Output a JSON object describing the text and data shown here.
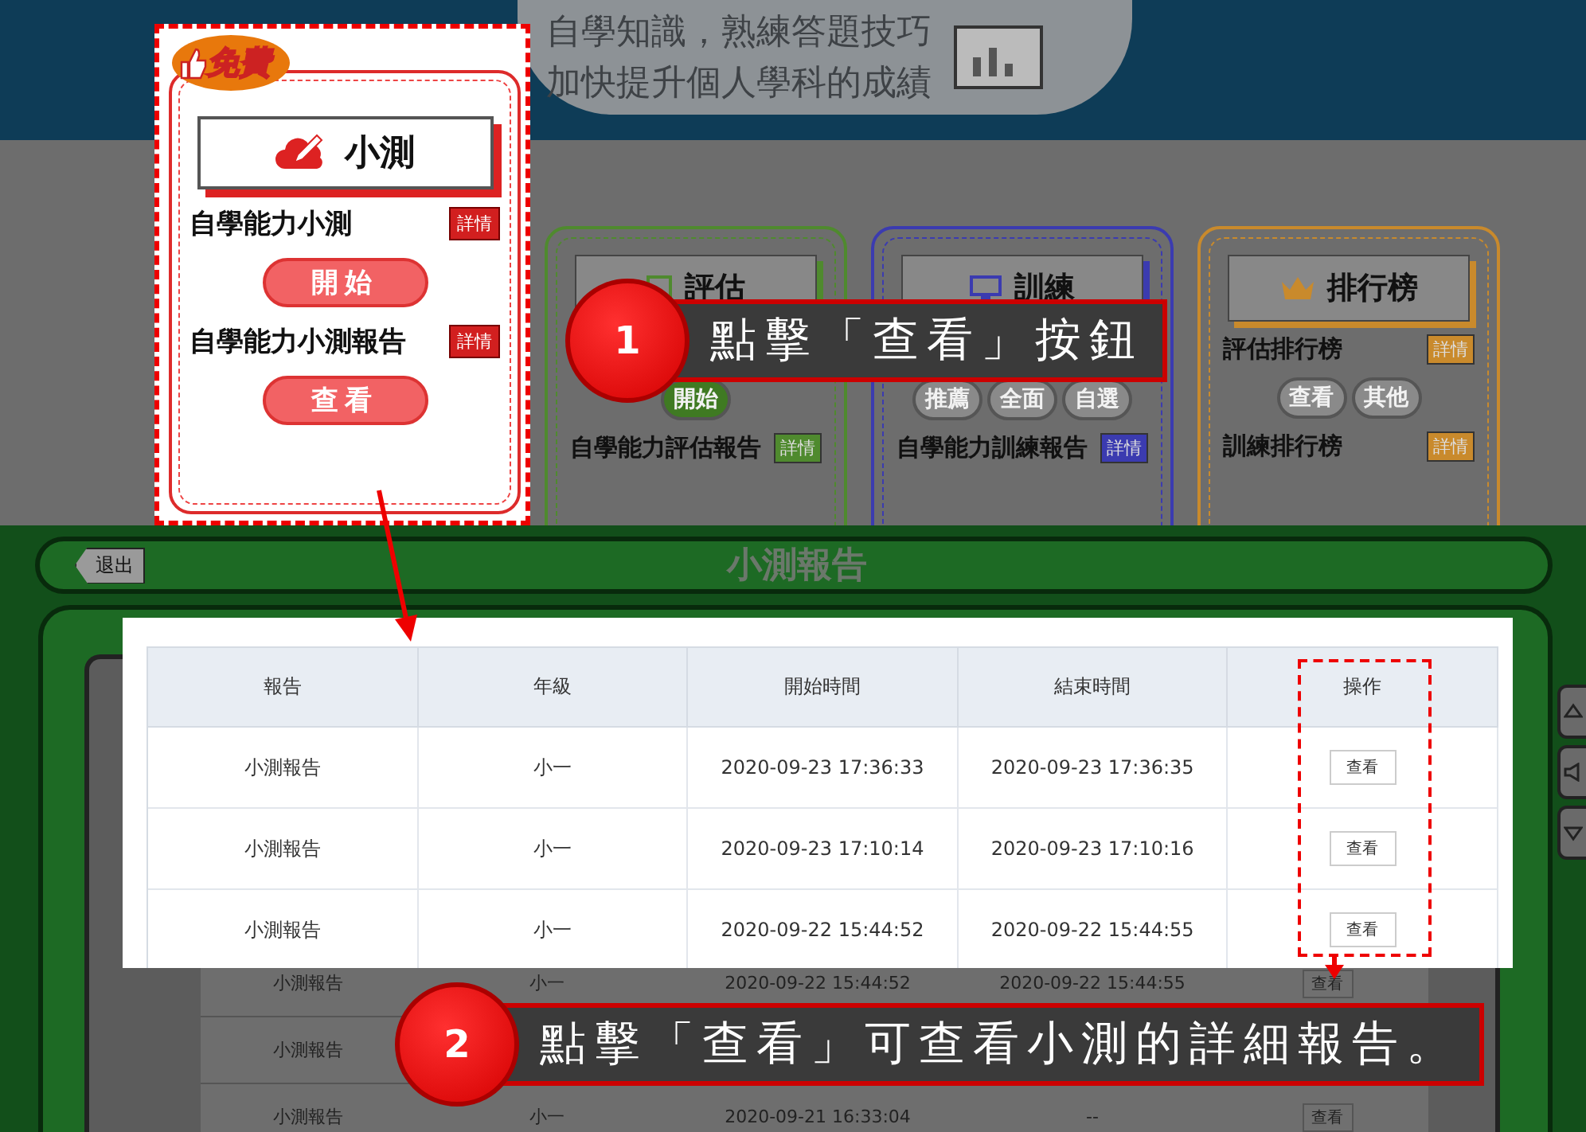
{
  "banner": {
    "lines": [
      "自學知識，熟練答題技巧",
      "加快提升個人學科的成績"
    ]
  },
  "quiz_card": {
    "badge": "免費",
    "title": "小測",
    "sections": [
      {
        "label": "自學能力小測",
        "detail": "詳情",
        "button": "開始"
      },
      {
        "label": "自學能力小測報告",
        "detail": "詳情",
        "button": "查看"
      }
    ]
  },
  "cards": [
    {
      "kind": "assess",
      "color": "#4f8a2e",
      "title": "評估",
      "sections": [
        {
          "buttons": [
            "開始"
          ]
        },
        {
          "label": "自學能力評估報告",
          "detail": "詳情"
        }
      ]
    },
    {
      "kind": "train",
      "color": "#3b3bb0",
      "title": "訓練",
      "sections": [
        {
          "buttons": [
            "推薦",
            "全面",
            "自選"
          ]
        },
        {
          "label": "自學能力訓練報告",
          "detail": "詳情"
        }
      ]
    },
    {
      "kind": "rank",
      "color": "#c98a2c",
      "title": "排行榜",
      "sections": [
        {
          "label": "評估排行榜",
          "detail": "詳情",
          "buttons": [
            "查看",
            "其他"
          ]
        },
        {
          "label": "訓練排行榜",
          "detail": "詳情"
        }
      ]
    }
  ],
  "report_screen": {
    "exit": "退出",
    "title": "小測報告",
    "rows": [
      {
        "cells": [
          "小測報告",
          "小一",
          "2020-09-22 15:44:52",
          "2020-09-22 15:44:55"
        ],
        "action": "查看"
      },
      {
        "cells": [
          "小測報告"
        ]
      },
      {
        "cells": [
          "小測報告",
          "小一",
          "2020-09-21 16:33:04",
          "--"
        ],
        "action": "查看"
      }
    ]
  },
  "report_table": {
    "columns": [
      "報告",
      "年級",
      "開始時間",
      "結束時間",
      "操作"
    ],
    "rows": [
      {
        "cells": [
          "小測報告",
          "小一",
          "2020-09-23 17:36:33",
          "2020-09-23 17:36:35"
        ],
        "action": "查看"
      },
      {
        "cells": [
          "小測報告",
          "小一",
          "2020-09-23 17:10:14",
          "2020-09-23 17:10:16"
        ],
        "action": "查看"
      },
      {
        "cells": [
          "小測報告",
          "小一",
          "2020-09-22 15:44:52",
          "2020-09-22 15:44:55"
        ],
        "action": "查看"
      }
    ]
  },
  "callouts": [
    {
      "number": "1",
      "text": "點擊「查看」按鈕"
    },
    {
      "number": "2",
      "text": "點擊「查看」可查看小測的詳細報告。"
    }
  ]
}
